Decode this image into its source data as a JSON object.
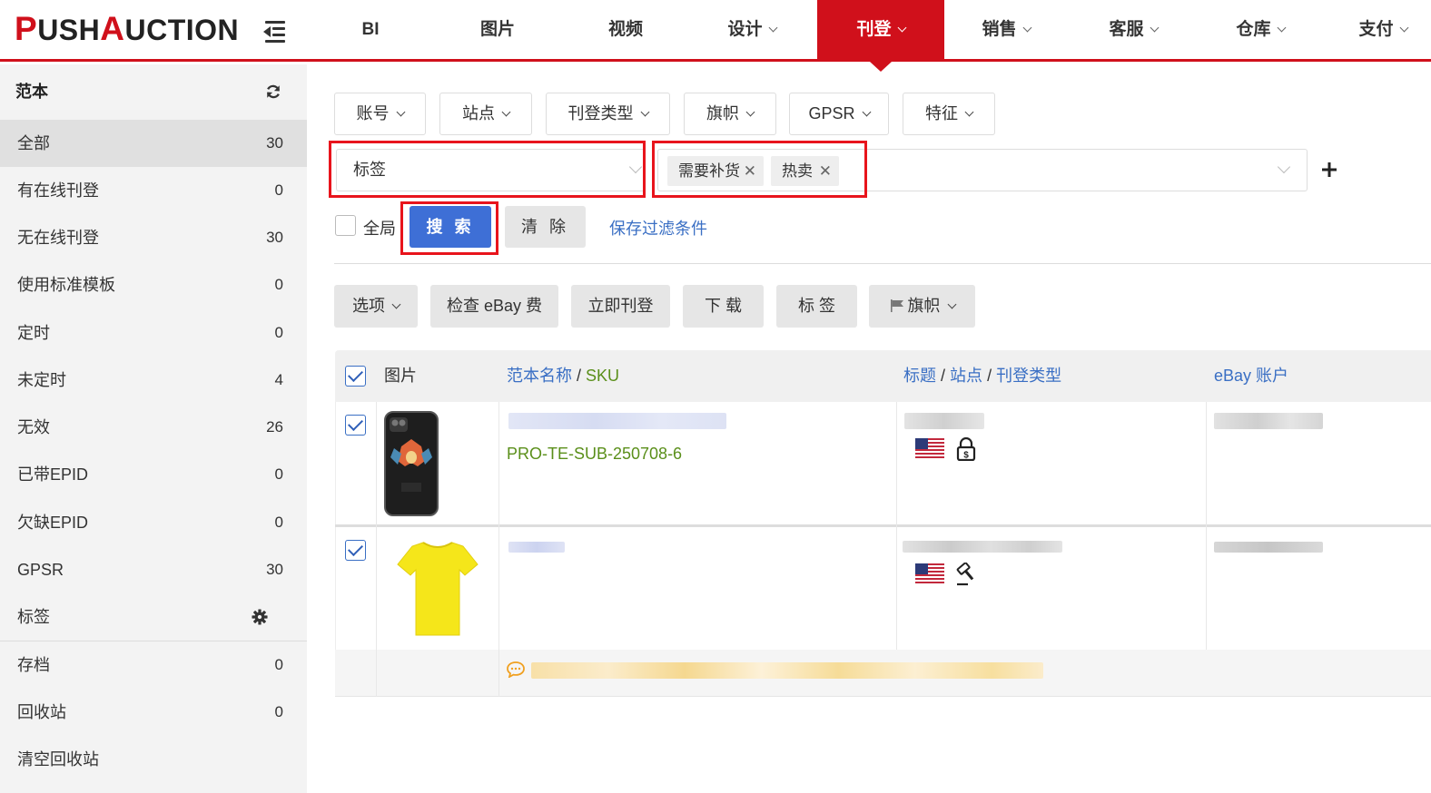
{
  "brand": {
    "logo_text_1": "P",
    "logo_text_2": "USH",
    "logo_text_3": "A",
    "logo_text_4": "UCTION",
    "accent_color": "#d0101b"
  },
  "nav": {
    "items": [
      {
        "label": "BI",
        "has_dropdown": false,
        "active": false
      },
      {
        "label": "图片",
        "has_dropdown": false,
        "active": false
      },
      {
        "label": "视频",
        "has_dropdown": false,
        "active": false
      },
      {
        "label": "设计",
        "has_dropdown": true,
        "active": false
      },
      {
        "label": "刊登",
        "has_dropdown": true,
        "active": true
      },
      {
        "label": "销售",
        "has_dropdown": true,
        "active": false
      },
      {
        "label": "客服",
        "has_dropdown": true,
        "active": false
      },
      {
        "label": "仓库",
        "has_dropdown": true,
        "active": false
      },
      {
        "label": "支付",
        "has_dropdown": true,
        "active": false
      }
    ]
  },
  "sidebar": {
    "title": "范本",
    "items": [
      {
        "label": "全部",
        "count": "30",
        "active": true
      },
      {
        "label": "有在线刊登",
        "count": "0"
      },
      {
        "label": "无在线刊登",
        "count": "30"
      },
      {
        "label": "使用标准模板",
        "count": "0"
      },
      {
        "label": "定时",
        "count": "0"
      },
      {
        "label": "未定时",
        "count": "4"
      },
      {
        "label": "无效",
        "count": "26"
      },
      {
        "label": "已带EPID",
        "count": "0"
      },
      {
        "label": "欠缺EPID",
        "count": "0"
      },
      {
        "label": "GPSR",
        "count": "30"
      },
      {
        "label": "标签",
        "count": ""
      },
      {
        "label": "存档",
        "count": "0"
      },
      {
        "label": "回收站",
        "count": "0"
      },
      {
        "label": "清空回收站",
        "count": ""
      }
    ]
  },
  "filters": {
    "dropdowns": [
      "账号",
      "站点",
      "刊登类型",
      "旗帜",
      "GPSR",
      "特征"
    ],
    "field_select": "标签",
    "tag_chips": [
      "需要补货",
      "热卖"
    ],
    "global_label": "全局",
    "search_label": "搜 索",
    "clear_label": "清 除",
    "save_filter_label": "保存过滤条件"
  },
  "actions": {
    "options_label": "选项",
    "check_fee_label": "检查 eBay 费",
    "publish_now_label": "立即刊登",
    "download_label": "下 载",
    "tag_label": "标 签",
    "flag_label": "旗帜"
  },
  "table": {
    "headers": {
      "image": "图片",
      "template_name": "范本名称",
      "sku": "SKU",
      "title": "标题",
      "site": "站点",
      "listing_type": "刊登类型",
      "ebay_account": "eBay 账户",
      "sep": "/"
    },
    "rows": [
      {
        "sku": "PRO-TE-SUB-250708-6",
        "site": "US",
        "listing_type_icon": "lock-dollar-icon",
        "image": "phone-case"
      },
      {
        "sku": "",
        "site": "US",
        "listing_type_icon": "gavel-icon",
        "image": "yellow-tshirt"
      }
    ]
  }
}
